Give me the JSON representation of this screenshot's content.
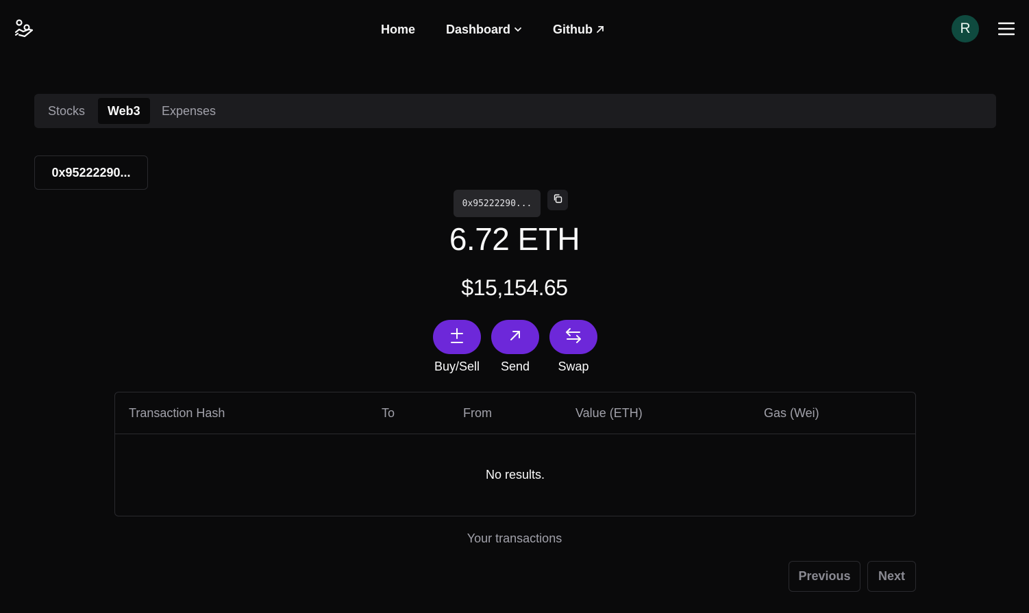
{
  "header": {
    "logo_icon": "hand-coins-icon",
    "nav": {
      "home": "Home",
      "dashboard": "Dashboard",
      "github": "Github"
    },
    "avatar_initial": "R",
    "menu_icon": "hamburger-menu-icon"
  },
  "tabs": [
    {
      "label": "Stocks",
      "active": false
    },
    {
      "label": "Web3",
      "active": true
    },
    {
      "label": "Expenses",
      "active": false
    }
  ],
  "wallet_select": {
    "value": "0x95222290..."
  },
  "wallet": {
    "address_short": "0x95222290...",
    "balance_eth": "6.72 ETH",
    "balance_usd": "$15,154.65"
  },
  "actions": [
    {
      "label": "Buy/Sell",
      "icon": "plus-minus-icon"
    },
    {
      "label": "Send",
      "icon": "arrow-up-right-icon"
    },
    {
      "label": "Swap",
      "icon": "swap-arrows-icon"
    }
  ],
  "transactions": {
    "columns": [
      "Transaction Hash",
      "To",
      "From",
      "Value (ETH)",
      "Gas (Wei)"
    ],
    "empty_text": "No results.",
    "caption": "Your transactions"
  },
  "pagination": {
    "previous": "Previous",
    "next": "Next"
  },
  "colors": {
    "background": "#0a0a0b",
    "accent": "#6d28d9",
    "avatar_bg": "#0f4a3f",
    "muted_text": "#a1a1aa"
  }
}
